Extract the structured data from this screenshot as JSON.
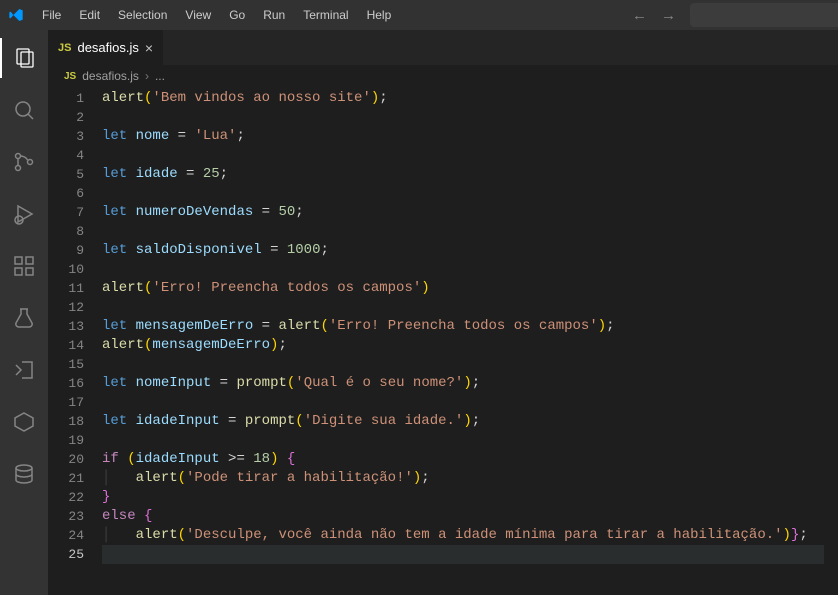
{
  "menu": [
    "File",
    "Edit",
    "Selection",
    "View",
    "Go",
    "Run",
    "Terminal",
    "Help"
  ],
  "tab": {
    "icon": "JS",
    "name": "desafios.js"
  },
  "breadcrumb": {
    "icon": "JS",
    "file": "desafios.js",
    "sep": "›",
    "more": "..."
  },
  "lineCount": 25,
  "currentLine": 25,
  "code": {
    "l1": {
      "fn": "alert",
      "p1": "(",
      "s": "'Bem vindos ao nosso site'",
      "p2": ")",
      "end": ";"
    },
    "l3": {
      "kw": "let",
      "sp": " ",
      "var": "nome",
      "sp2": " ",
      "op": "=",
      "sp3": " ",
      "s": "'Lua'",
      "end": ";"
    },
    "l5": {
      "kw": "let",
      "sp": " ",
      "var": "idade",
      "sp2": " ",
      "op": "=",
      "sp3": " ",
      "num": "25",
      "end": ";"
    },
    "l7": {
      "kw": "let",
      "sp": " ",
      "var": "numeroDeVendas",
      "sp2": " ",
      "op": "=",
      "sp3": " ",
      "num": "50",
      "end": ";"
    },
    "l9": {
      "kw": "let",
      "sp": " ",
      "var": "saldoDisponivel",
      "sp2": " ",
      "op": "=",
      "sp3": " ",
      "num": "1000",
      "end": ";"
    },
    "l11": {
      "fn": "alert",
      "p1": "(",
      "s": "'Erro! Preencha todos os campos'",
      "p2": ")"
    },
    "l13": {
      "kw": "let",
      "sp": " ",
      "var": "mensagemDeErro",
      "sp2": " ",
      "op": "=",
      "sp3": " ",
      "fn": "alert",
      "p1": "(",
      "s": "'Erro! Preencha todos os campos'",
      "p2": ")",
      "end": ";"
    },
    "l14": {
      "fn": "alert",
      "p1": "(",
      "var": "mensagemDeErro",
      "p2": ")",
      "end": ";"
    },
    "l16": {
      "kw": "let",
      "sp": " ",
      "var": "nomeInput",
      "sp2": " ",
      "op": "=",
      "sp3": " ",
      "fn": "prompt",
      "p1": "(",
      "s": "'Qual é o seu nome?'",
      "p2": ")",
      "end": ";"
    },
    "l18": {
      "kw": "let",
      "sp": " ",
      "var": "idadeInput",
      "sp2": " ",
      "op": "=",
      "sp3": " ",
      "fn": "prompt",
      "p1": "(",
      "s": "'Digite sua idade.'",
      "p2": ")",
      "end": ";"
    },
    "l20": {
      "ctrl": "if",
      "sp": " ",
      "p1": "(",
      "var": "idadeInput",
      "sp2": " ",
      "op": ">=",
      "sp3": " ",
      "num": "18",
      "p2": ")",
      "sp4": " ",
      "br": "{"
    },
    "l21": {
      "fn": "alert",
      "p1": "(",
      "s": "'Pode tirar a habilitação!'",
      "p2": ")",
      "end": ";"
    },
    "l22": {
      "br": "}"
    },
    "l23": {
      "ctrl": "else",
      "sp": " ",
      "br": "{"
    },
    "l24": {
      "fn": "alert",
      "p1": "(",
      "s": "'Desculpe, você ainda não tem a idade mínima para tirar a habilitação.'",
      "p2": ")",
      "br": "}",
      "end": ";"
    },
    "indent": "    ",
    "guide": "│   "
  }
}
